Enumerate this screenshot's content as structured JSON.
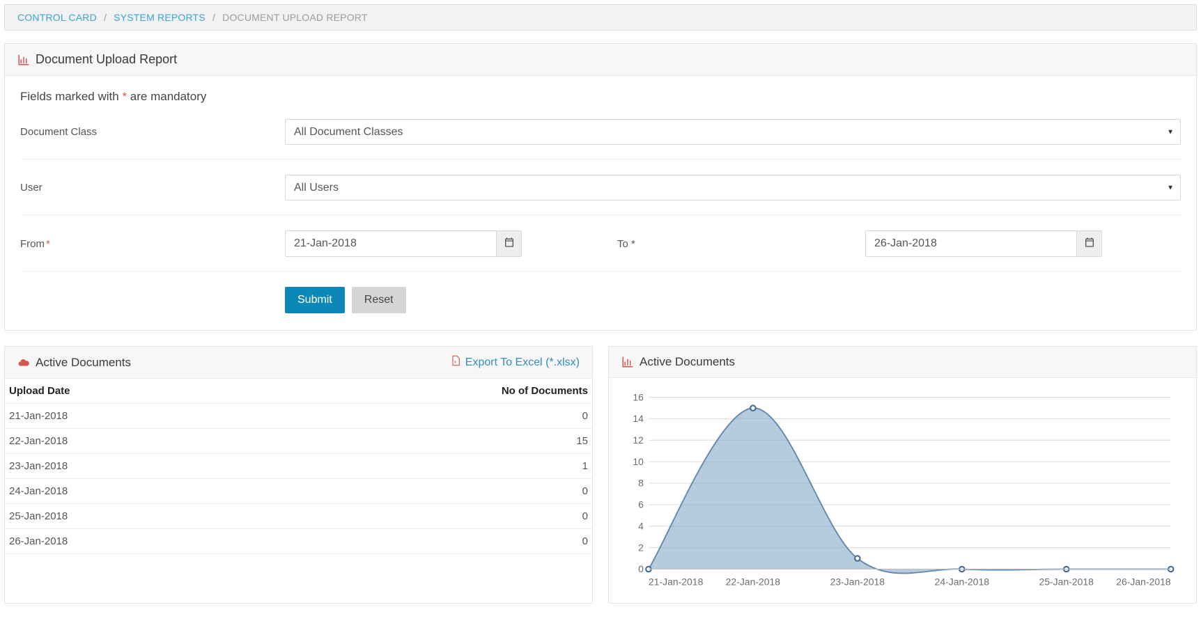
{
  "breadcrumb": {
    "items": [
      {
        "label": "CONTROL CARD",
        "link": true
      },
      {
        "label": "SYSTEM REPORTS",
        "link": true
      },
      {
        "label": "DOCUMENT UPLOAD REPORT",
        "link": false
      }
    ]
  },
  "report": {
    "title": "Document Upload Report",
    "mandatory_prefix": "Fields marked with ",
    "mandatory_suffix": " are mandatory",
    "ast": "*",
    "form": {
      "doc_class_label": "Document Class",
      "doc_class_value": "All Document Classes",
      "user_label": "User",
      "user_value": "All Users",
      "from_label": "From",
      "from_value": "21-Jan-2018",
      "to_label": "To",
      "to_value": "26-Jan-2018",
      "submit": "Submit",
      "reset": "Reset"
    }
  },
  "table_panel": {
    "title": "Active Documents",
    "export_label": "Export To Excel (*.xlsx)",
    "col_date": "Upload Date",
    "col_count": "No of Documents",
    "rows": [
      {
        "date": "21-Jan-2018",
        "count": "0"
      },
      {
        "date": "22-Jan-2018",
        "count": "15"
      },
      {
        "date": "23-Jan-2018",
        "count": "1"
      },
      {
        "date": "24-Jan-2018",
        "count": "0"
      },
      {
        "date": "25-Jan-2018",
        "count": "0"
      },
      {
        "date": "26-Jan-2018",
        "count": "0"
      }
    ]
  },
  "chart_panel": {
    "title": "Active Documents"
  },
  "chart_data": {
    "type": "area",
    "title": "Active Documents",
    "xlabel": "",
    "ylabel": "",
    "ylim": [
      0,
      16
    ],
    "yticks": [
      0,
      2,
      4,
      6,
      8,
      10,
      12,
      14,
      16
    ],
    "categories": [
      "21-Jan-2018",
      "22-Jan-2018",
      "23-Jan-2018",
      "24-Jan-2018",
      "25-Jan-2018",
      "26-Jan-2018"
    ],
    "values": [
      0,
      15,
      1,
      0,
      0,
      0
    ]
  }
}
